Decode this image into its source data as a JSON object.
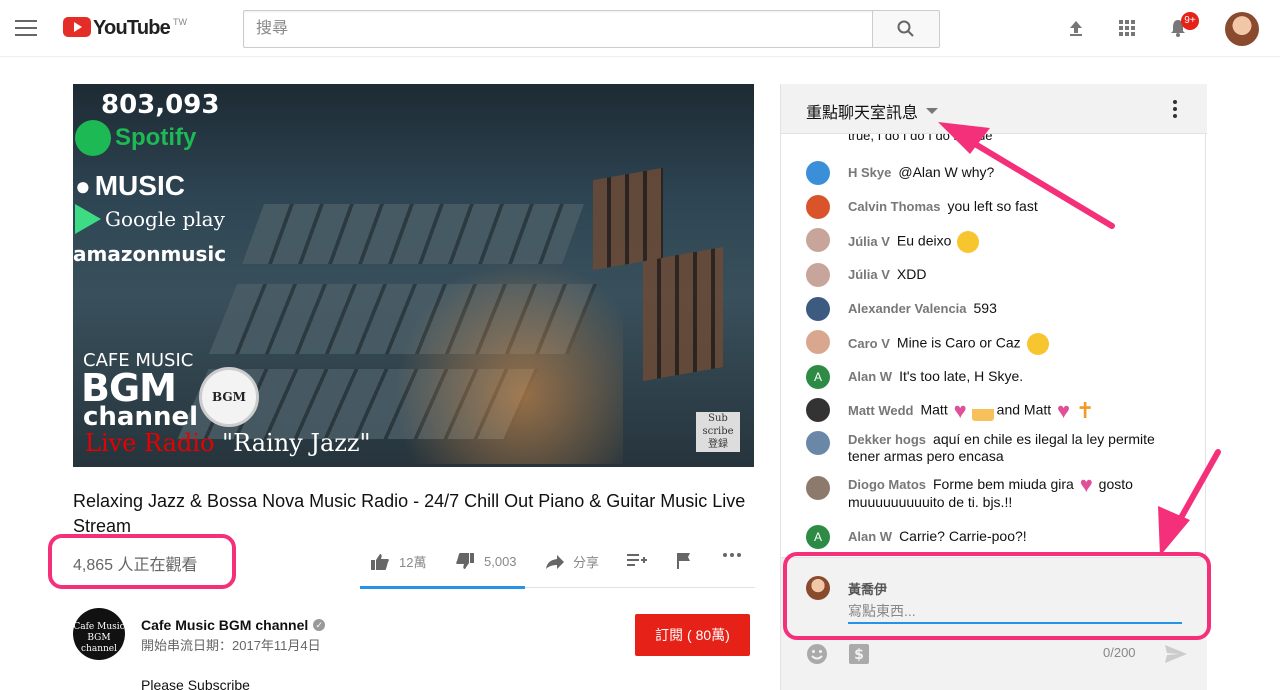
{
  "header": {
    "logo_text": "YouTube",
    "logo_region": "TW",
    "search_placeholder": "搜尋",
    "notification_count": "9+"
  },
  "video": {
    "overlay": {
      "count": "803,093",
      "spotify": "Spotify",
      "music": "MUSIC",
      "gplay": "Google play",
      "amazon": "amazonmusic",
      "cafe_music": "CAFE MUSIC",
      "bgm": "BGM",
      "channel": "channel",
      "bgm_badge": "BGM",
      "live_radio": "Live Radio",
      "rainy": " \"Rainy Jazz\"",
      "subscribe_line1": "Sub",
      "subscribe_line2": "scribe",
      "subscribe_line3": "登録"
    },
    "title": "Relaxing Jazz & Bossa Nova Music Radio - 24/7 Chill Out Piano & Guitar Music Live Stream",
    "viewers": "4,865 人正在觀看",
    "likes": "12萬",
    "dislikes": "5,003",
    "share_label": "分享"
  },
  "channel": {
    "avatar_text": "Cafe Music BGM channel",
    "name": "Cafe Music BGM channel",
    "stream_date": "開始串流日期：2017年11月4日",
    "subscribe_label": "訂閱 ( 80萬)",
    "description_start": "Please Subscribe"
  },
  "chat": {
    "header_title": "重點聊天室訊息",
    "clipped_text": "true, I do I do I do its true",
    "messages": [
      {
        "author": "H Skye",
        "text": "@Alan W why?",
        "avatar_color": "#3b8fd9"
      },
      {
        "author": "Calvin Thomas",
        "text": "you left so fast",
        "avatar_color": "#d9542b"
      },
      {
        "author": "Júlia V",
        "text": "Eu deixo",
        "avatar_color": "#c7a59a"
      },
      {
        "author": "Júlia V",
        "text": "XDD",
        "avatar_color": "#c7a59a"
      },
      {
        "author": "Alexander Valencia",
        "text": "593",
        "avatar_color": "#3d5a80"
      },
      {
        "author": "Caro V",
        "text": "Mine is Caro or Caz",
        "avatar_color": "#d8a78e"
      },
      {
        "author": "Alan W",
        "text": "It's too late, H Skye.",
        "avatar_color": "#2e8b45",
        "initial": "A"
      },
      {
        "author": "Matt Wedd",
        "text_a": "Matt",
        "text_b": "and Matt",
        "avatar_color": "#333"
      },
      {
        "author": "Dekker hogs",
        "text": "aquí en chile es ilegal la ley permite tener armas pero encasa",
        "avatar_color": "#6b87a8"
      },
      {
        "author": "Diogo Matos",
        "text_a": "Forme bem miuda gira",
        "text_b": "gosto muuuuuuuuuito de ti. bjs.!!",
        "avatar_color": "#8c7a6c"
      },
      {
        "author": "Alan W",
        "text": "Carrie? Carrie-poo?!",
        "avatar_color": "#2e8b45",
        "initial": "A"
      }
    ],
    "input": {
      "user_name": "黃喬伊",
      "placeholder": "寫點東西...",
      "char_count": "0/200"
    }
  },
  "colors": {
    "youtube_red": "#e52d27",
    "annotation_pink": "#f5307b",
    "focus_blue": "#2793e6"
  }
}
